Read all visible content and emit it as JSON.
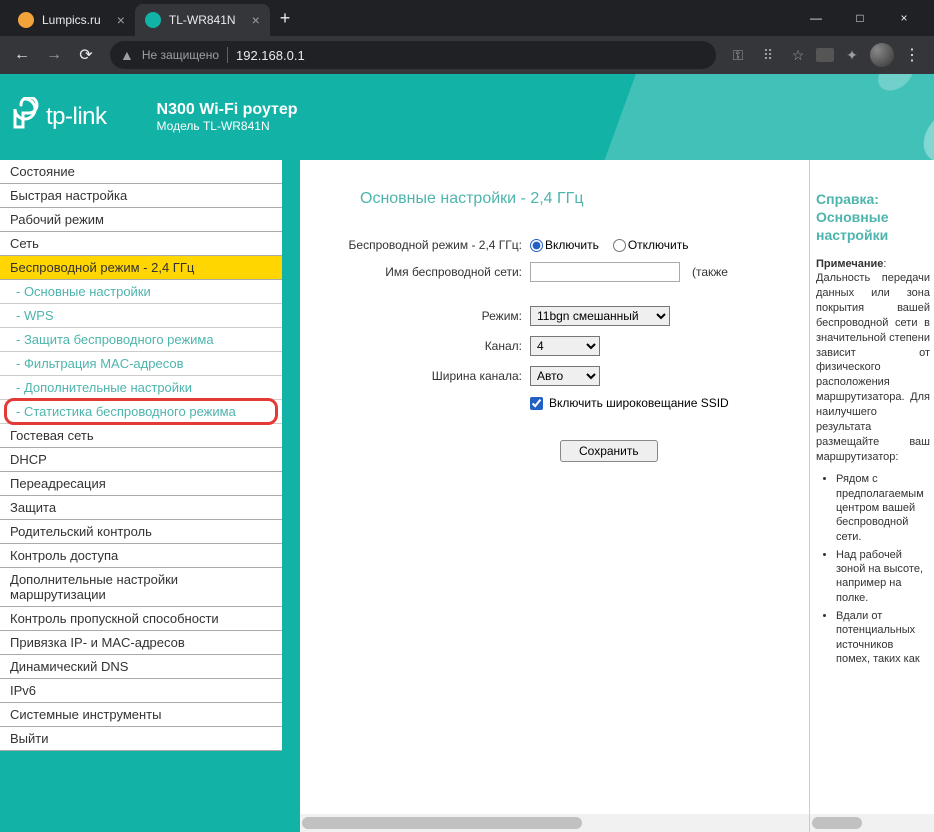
{
  "browser": {
    "tabs": [
      {
        "title": "Lumpics.ru",
        "favicon_color": "#f2a33a",
        "active": false
      },
      {
        "title": "TL-WR841N",
        "favicon_color": "#12b2a6",
        "active": true
      }
    ],
    "security_text": "Не защищено",
    "url": "192.168.0.1"
  },
  "header": {
    "brand": "tp-link",
    "title": "N300 Wi-Fi роутер",
    "model": "Модель TL-WR841N"
  },
  "sidebar": {
    "items": [
      {
        "label": "Состояние",
        "type": "item"
      },
      {
        "label": "Быстрая настройка",
        "type": "item"
      },
      {
        "label": "Рабочий режим",
        "type": "item"
      },
      {
        "label": "Сеть",
        "type": "item"
      },
      {
        "label": "Беспроводной режим - 2,4 ГГц",
        "type": "item",
        "active": true
      },
      {
        "label": "- Основные настройки",
        "type": "sub"
      },
      {
        "label": "- WPS",
        "type": "sub"
      },
      {
        "label": "- Защита беспроводного режима",
        "type": "sub"
      },
      {
        "label": "- Фильтрация MAC-адресов",
        "type": "sub"
      },
      {
        "label": "- Дополнительные настройки",
        "type": "sub"
      },
      {
        "label": "- Статистика беспроводного режима",
        "type": "sub",
        "highlighted": true
      },
      {
        "label": "Гостевая сеть",
        "type": "item"
      },
      {
        "label": "DHCP",
        "type": "item"
      },
      {
        "label": "Переадресация",
        "type": "item"
      },
      {
        "label": "Защита",
        "type": "item"
      },
      {
        "label": "Родительский контроль",
        "type": "item"
      },
      {
        "label": "Контроль доступа",
        "type": "item"
      },
      {
        "label": "Дополнительные настройки маршрутизации",
        "type": "item"
      },
      {
        "label": "Контроль пропускной способности",
        "type": "item"
      },
      {
        "label": "Привязка IP- и MAC-адресов",
        "type": "item"
      },
      {
        "label": "Динамический DNS",
        "type": "item"
      },
      {
        "label": "IPv6",
        "type": "item"
      },
      {
        "label": "Системные инструменты",
        "type": "item"
      },
      {
        "label": "Выйти",
        "type": "item"
      }
    ]
  },
  "main": {
    "title": "Основные настройки - 2,4 ГГц",
    "rows": {
      "wireless_label": "Беспроводной режим - 2,4 ГГц:",
      "enable": "Включить",
      "disable": "Отключить",
      "ssid_label": "Имя беспроводной сети:",
      "ssid_value": "",
      "also": "(также",
      "mode_label": "Режим:",
      "mode_value": "11bgn смешанный",
      "channel_label": "Канал:",
      "channel_value": "4",
      "width_label": "Ширина канала:",
      "width_value": "Авто",
      "broadcast": "Включить широковещание SSID"
    },
    "save": "Сохранить"
  },
  "help": {
    "title": "Справка: Основные настройки",
    "note_label": "Примечание",
    "note_body": "Дальность передачи данных или зона покрытия вашей беспроводной сети в значительной степени зависит от физического расположения маршрутизатора. Для наилучшего результата размещайте ваш маршрутизатор:",
    "bullets": [
      "Рядом с предполагаемым центром вашей беспроводной сети.",
      "Над рабочей зоной на высоте, например на полке.",
      "Вдали от потенциальных источников помех, таких как"
    ]
  }
}
